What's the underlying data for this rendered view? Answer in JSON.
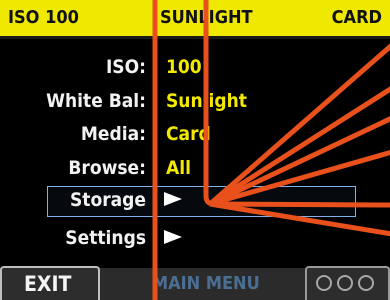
{
  "status_bar": {
    "iso": "ISO 100",
    "white_balance": "SUNLIGHT",
    "media": "CARD"
  },
  "menu": {
    "items": [
      {
        "label": "ISO:",
        "value": "100"
      },
      {
        "label": "White Bal:",
        "value": "Sunlight"
      },
      {
        "label": "Media:",
        "value": "Card"
      },
      {
        "label": "Browse:",
        "value": "All"
      },
      {
        "label": "Storage",
        "submenu": true,
        "selected": true
      },
      {
        "label": "Settings",
        "submenu": true
      }
    ]
  },
  "footer": {
    "exit_label": "EXIT",
    "title": "MAIN MENU",
    "control_icon": "three-dial-icon"
  },
  "colors": {
    "accent_yellow": "#efe800",
    "text": "#f2f2f2",
    "selection": "#7fb2ea",
    "annotation": "#e8501c"
  }
}
